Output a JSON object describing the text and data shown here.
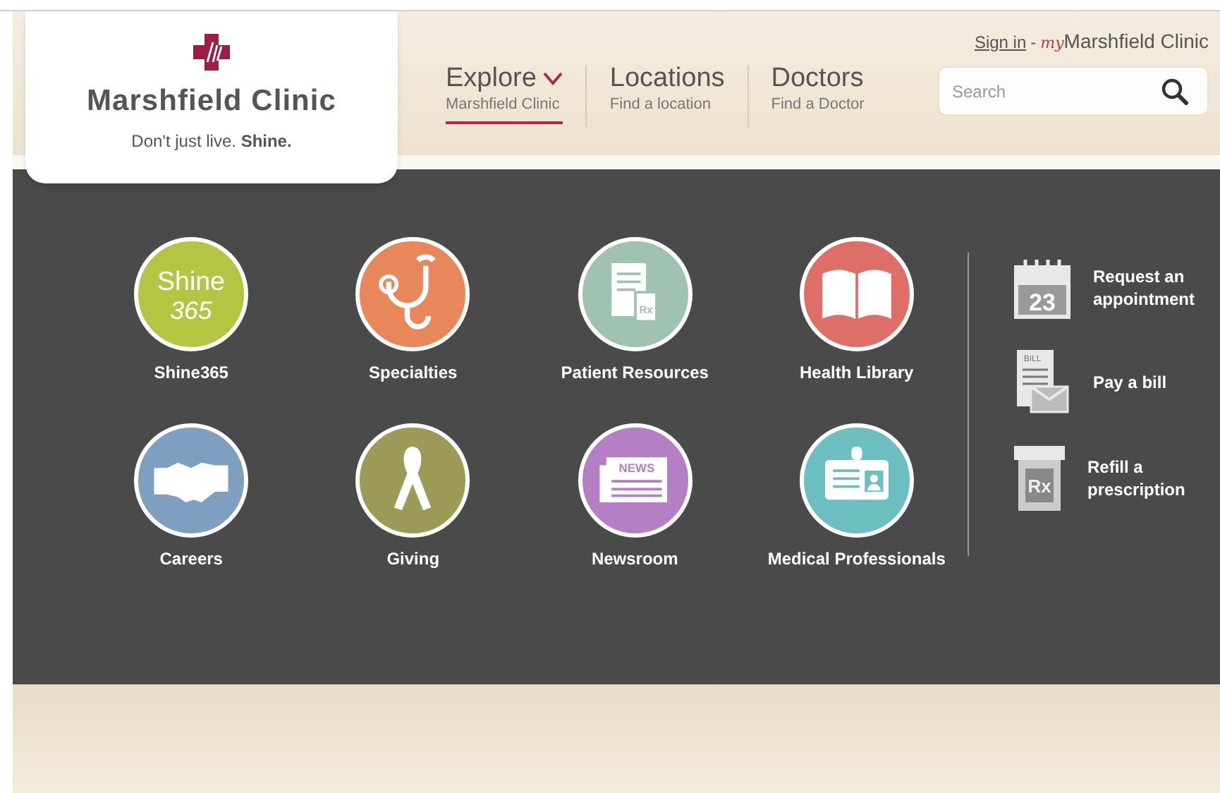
{
  "logo": {
    "name": "Marshfield Clinic",
    "tagline": "Don't just live. **Shine.**"
  },
  "nav": [
    {
      "label": "Explore",
      "sublabel": "Marshfield Clinic",
      "selected": true
    },
    {
      "label": "Locations",
      "sublabel": "Find a location",
      "selected": false
    },
    {
      "label": "Doctors",
      "sublabel": "Find a Doctor",
      "selected": false
    }
  ],
  "account": {
    "sign_in": "Sign in",
    "separator": "-",
    "my": "my",
    "portal": "Marshfield Clinic"
  },
  "search": {
    "placeholder": "Search"
  },
  "explore_menu": [
    {
      "kind": "shine",
      "label": "Shine365",
      "color": "#b5c543",
      "icon_text": [
        "Shine",
        "365"
      ]
    },
    {
      "kind": "stethoscope",
      "label": "Specialties",
      "color": "#e8885a"
    },
    {
      "kind": "document",
      "label": "Patient Resources",
      "color": "#9fc3b0",
      "icon_text": [
        "Rx"
      ]
    },
    {
      "kind": "book",
      "label": "Health Library",
      "color": "#de6f68"
    },
    {
      "kind": "handshake",
      "label": "Careers",
      "color": "#7f9fc0"
    },
    {
      "kind": "ribbon",
      "label": "Giving",
      "color": "#9b9b57"
    },
    {
      "kind": "news",
      "label": "Newsroom",
      "color": "#b57fc6",
      "icon_text": [
        "NEWS"
      ]
    },
    {
      "kind": "badge",
      "label": "Medical Professionals",
      "color": "#6cbfc0"
    }
  ],
  "quick_links": [
    {
      "kind": "calendar",
      "label": "Request an appointment",
      "icon_text": "23"
    },
    {
      "kind": "bill",
      "label": "Pay a bill",
      "icon_text": "BILL"
    },
    {
      "kind": "rx",
      "label": "Refill a prescription",
      "icon_text": "Rx"
    }
  ]
}
